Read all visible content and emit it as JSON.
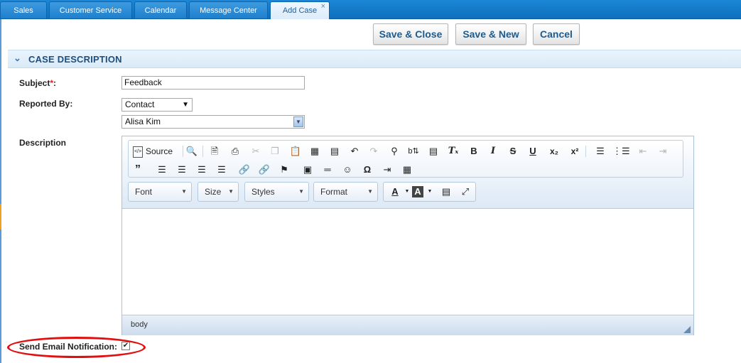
{
  "tabs": [
    {
      "label": "Sales"
    },
    {
      "label": "Customer Service"
    },
    {
      "label": "Calendar"
    },
    {
      "label": "Message Center"
    },
    {
      "label": "Add Case",
      "active": true
    }
  ],
  "tab_close_glyph": "×",
  "actions": {
    "save_close": "Save & Close",
    "save_new": "Save & New",
    "cancel": "Cancel"
  },
  "section": {
    "title": "CASE DESCRIPTION"
  },
  "form": {
    "subject_label": "Subject",
    "subject_required": "*",
    "subject_colon": ":",
    "subject_value": "Feedback",
    "reported_by_label": "Reported By:",
    "reported_by_type": "Contact",
    "reported_by_contact": "Alisa  Kim",
    "description_label": "Description"
  },
  "editor": {
    "source_label": "Source",
    "combos": {
      "font": "Font",
      "size": "Size",
      "styles": "Styles",
      "format": "Format"
    },
    "status_path": "body",
    "icons": [
      "preview-icon",
      "new-page-icon",
      "print-icon",
      "cut-icon",
      "copy-icon",
      "paste-icon",
      "paste-word-icon",
      "paste-text-icon",
      "undo-icon",
      "redo-icon",
      "find-icon",
      "replace-icon",
      "select-all-icon",
      "remove-format-icon",
      "bold-icon",
      "italic-icon",
      "strike-icon",
      "underline-icon",
      "subscript-icon",
      "superscript-icon",
      "numbered-list-icon",
      "bullet-list-icon",
      "outdent-icon",
      "indent-icon",
      "blockquote-icon",
      "align-left-icon",
      "align-center-icon",
      "align-right-icon",
      "justify-icon",
      "link-icon",
      "unlink-icon",
      "anchor-icon",
      "image-icon",
      "horizontal-rule-icon",
      "smiley-icon",
      "special-char-icon",
      "page-break-icon",
      "table-icon",
      "text-color-icon",
      "bg-color-icon",
      "show-blocks-icon",
      "maximize-icon"
    ]
  },
  "notify": {
    "label": "Send Email Notification:",
    "checked": true
  }
}
